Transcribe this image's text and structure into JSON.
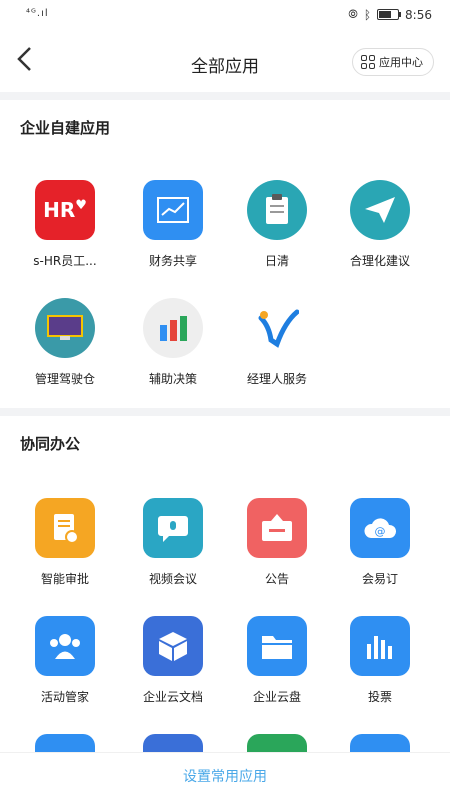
{
  "status": {
    "signal": "⁴ᴳ.ıl",
    "time": "8:56",
    "battery_level": 0.7
  },
  "header": {
    "title": "全部应用",
    "app_center_label": "应用中心"
  },
  "sections": [
    {
      "title": "企业自建应用",
      "apps": [
        {
          "label": "s-HR员工...",
          "icon": "hr-heart-icon",
          "color": "#e52229"
        },
        {
          "label": "财务共享",
          "icon": "chart-icon",
          "color": "#2f8ff2"
        },
        {
          "label": "日清",
          "icon": "clipboard-icon",
          "color": "#2aa6b4"
        },
        {
          "label": "合理化建议",
          "icon": "paper-plane-icon",
          "color": "#2aa6b4"
        },
        {
          "label": "管理驾驶仓",
          "icon": "monitor-icon",
          "color": "#3a9aa8"
        },
        {
          "label": "辅助决策",
          "icon": "bar-chart-icon",
          "color": "#eeeeee"
        },
        {
          "label": "经理人服务",
          "icon": "v-logo-icon",
          "color": "#1e7ee0"
        }
      ]
    },
    {
      "title": "协同办公",
      "apps": [
        {
          "label": "智能审批",
          "icon": "approval-doc-icon",
          "color": "#f5a623"
        },
        {
          "label": "视频会议",
          "icon": "video-chat-icon",
          "color": "#2aa6c4"
        },
        {
          "label": "公告",
          "icon": "announcement-icon",
          "color": "#f06262"
        },
        {
          "label": "会易订",
          "icon": "cloud-at-icon",
          "color": "#2f8ff2"
        },
        {
          "label": "活动管家",
          "icon": "people-icon",
          "color": "#2f8ff2"
        },
        {
          "label": "企业云文档",
          "icon": "cube-icon",
          "color": "#3a6fd8"
        },
        {
          "label": "企业云盘",
          "icon": "folder-icon",
          "color": "#2f8ff2"
        },
        {
          "label": "投票",
          "icon": "vote-bars-icon",
          "color": "#2f8ff2"
        }
      ]
    }
  ],
  "footer": {
    "label": "设置常用应用"
  }
}
